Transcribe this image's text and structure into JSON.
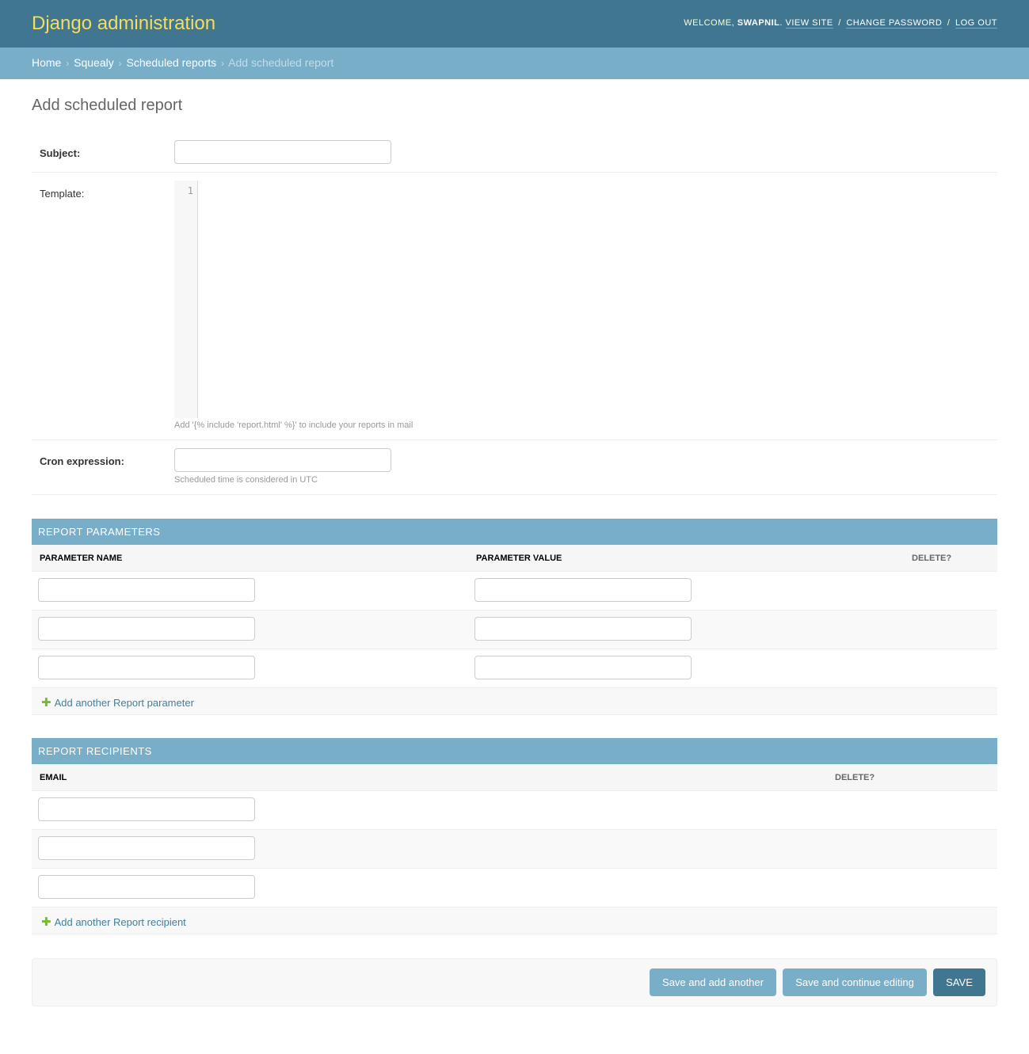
{
  "header": {
    "branding": "Django administration",
    "welcome": "WELCOME,",
    "username": "SWAPNIL",
    "view_site": "VIEW SITE",
    "change_password": "CHANGE PASSWORD",
    "log_out": "LOG OUT"
  },
  "breadcrumbs": {
    "home": "Home",
    "app": "Squealy",
    "model": "Scheduled reports",
    "current": "Add scheduled report",
    "separator": "›"
  },
  "page": {
    "title": "Add scheduled report"
  },
  "form": {
    "subject": {
      "label": "Subject:",
      "value": ""
    },
    "template": {
      "label": "Template:",
      "line_number": "1",
      "help": "Add '{% include 'report.html' %}' to include your reports in mail"
    },
    "cron": {
      "label": "Cron expression:",
      "value": "",
      "help": "Scheduled time is considered in UTC"
    }
  },
  "params_inline": {
    "title": "REPORT PARAMETERS",
    "col_name": "PARAMETER NAME",
    "col_value": "PARAMETER VALUE",
    "col_delete": "DELETE?",
    "rows": [
      {
        "name": "",
        "value": ""
      },
      {
        "name": "",
        "value": ""
      },
      {
        "name": "",
        "value": ""
      }
    ],
    "add_label": "Add another Report parameter"
  },
  "recipients_inline": {
    "title": "REPORT RECIPIENTS",
    "col_email": "EMAIL",
    "col_delete": "DELETE?",
    "rows": [
      {
        "email": ""
      },
      {
        "email": ""
      },
      {
        "email": ""
      }
    ],
    "add_label": "Add another Report recipient"
  },
  "submit": {
    "save_add_another": "Save and add another",
    "save_continue": "Save and continue editing",
    "save": "SAVE"
  },
  "colors": {
    "header_bg": "#417690",
    "branding": "#f5dd5d",
    "breadcrumb_bg": "#79aec8",
    "add_icon": "#70bf2b",
    "link": "#447e9b"
  }
}
